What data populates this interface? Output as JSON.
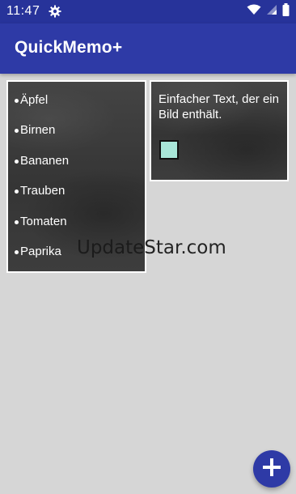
{
  "status_bar": {
    "time": "11:47",
    "icons": [
      "settings-icon",
      "wifi-icon",
      "signal-icon",
      "battery-icon"
    ],
    "color": "#27339a"
  },
  "app_bar": {
    "title": "QuickMemo+",
    "color": "#2e3aa6"
  },
  "notes": [
    {
      "type": "list",
      "items": [
        "Äpfel",
        "Birnen",
        "Bananen",
        "Trauben",
        "Tomaten",
        "Paprika"
      ]
    },
    {
      "type": "text-with-image",
      "text": "Einfacher Text, der ein Bild enthält.",
      "image_color": "#a8e6d8"
    }
  ],
  "watermark": {
    "text": "UpdateStar.com"
  },
  "fab": {
    "icon": "plus-icon",
    "color": "#2e3aa6"
  }
}
